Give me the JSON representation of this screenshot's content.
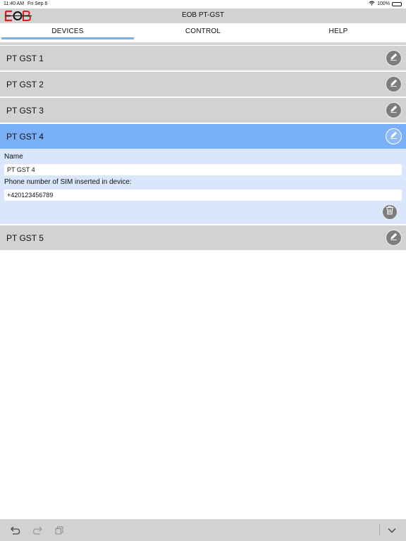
{
  "status_bar": {
    "time": "11:40 AM",
    "date": "Fri Sep 6",
    "battery": "100%",
    "icons": [
      "wifi-icon",
      "battery-icon"
    ]
  },
  "app": {
    "title": "EOB PT-GST",
    "logo": "EOB",
    "colors": {
      "logo_red": "#d42020",
      "accent": "#7ab0f7",
      "bar_gray": "#d2d2d2",
      "detail_bg": "#d9e6fb"
    }
  },
  "tabs": [
    {
      "label": "DEVICES",
      "active": true
    },
    {
      "label": "CONTROL",
      "active": false
    },
    {
      "label": "HELP",
      "active": false
    }
  ],
  "devices": [
    {
      "name": "PT GST 1",
      "icon": "pencil-icon"
    },
    {
      "name": "PT GST 2",
      "icon": "pencil-icon"
    },
    {
      "name": "PT GST 3",
      "icon": "pencil-icon"
    },
    {
      "name": "PT GST 4",
      "icon": "pencil-icon",
      "selected": true
    },
    {
      "name": "PT GST 5",
      "icon": "pencil-icon"
    }
  ],
  "details": {
    "name_label": "Name",
    "name_value": "PT GST 4",
    "phone_label": "Phone number of SIM inserted in device:",
    "phone_value": "+420123456789",
    "delete_icon": "trash-icon"
  },
  "toolbar": {
    "icons": [
      "undo-icon",
      "redo-icon",
      "paste-icon",
      "chevron-down-icon"
    ]
  }
}
